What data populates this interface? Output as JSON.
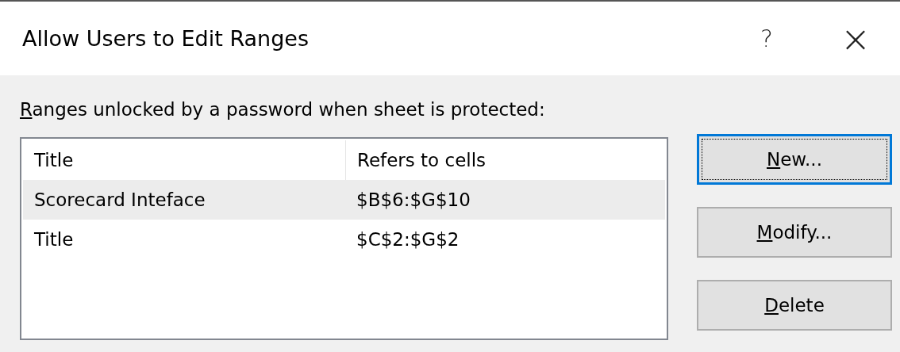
{
  "window": {
    "title": "Allow Users to Edit Ranges",
    "help": "?",
    "close": "×"
  },
  "ranges_label": {
    "access_key": "R",
    "rest": "anges unlocked by a password when sheet is protected:"
  },
  "table": {
    "columns": [
      "Title",
      "Refers to cells"
    ],
    "rows": [
      {
        "title": "Scorecard Inteface",
        "refers_to": "$B$6:$G$10",
        "selected": true
      },
      {
        "title": "Title",
        "refers_to": "$C$2:$G$2",
        "selected": false
      }
    ]
  },
  "buttons": [
    {
      "access_key": "N",
      "rest": "ew...",
      "default": true
    },
    {
      "access_key": "M",
      "rest": "odify...",
      "default": false
    },
    {
      "access_key": "D",
      "rest": "elete",
      "default": false
    }
  ]
}
